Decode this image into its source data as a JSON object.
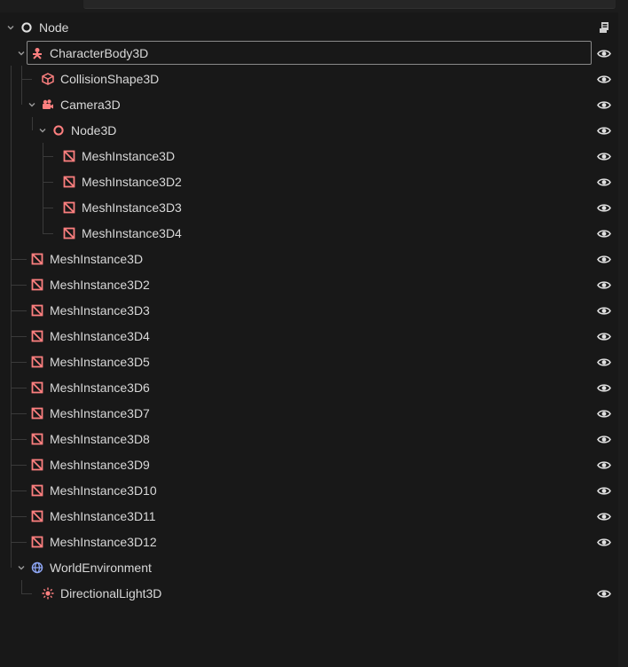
{
  "scene_tree": {
    "root": {
      "label": "Node",
      "icon": "node-icon"
    },
    "rows": [
      {
        "label": "CharacterBody3D",
        "icon": "character-body-icon",
        "selected": true
      },
      {
        "label": "CollisionShape3D",
        "icon": "collision-shape-icon"
      },
      {
        "label": "Camera3D",
        "icon": "camera-icon"
      },
      {
        "label": "Node3D",
        "icon": "node3d-icon"
      },
      {
        "label": "MeshInstance3D",
        "icon": "mesh-icon"
      },
      {
        "label": "MeshInstance3D2",
        "icon": "mesh-icon"
      },
      {
        "label": "MeshInstance3D3",
        "icon": "mesh-icon"
      },
      {
        "label": "MeshInstance3D4",
        "icon": "mesh-icon"
      },
      {
        "label": "MeshInstance3D",
        "icon": "mesh-icon"
      },
      {
        "label": "MeshInstance3D2",
        "icon": "mesh-icon"
      },
      {
        "label": "MeshInstance3D3",
        "icon": "mesh-icon"
      },
      {
        "label": "MeshInstance3D4",
        "icon": "mesh-icon"
      },
      {
        "label": "MeshInstance3D5",
        "icon": "mesh-icon"
      },
      {
        "label": "MeshInstance3D6",
        "icon": "mesh-icon"
      },
      {
        "label": "MeshInstance3D7",
        "icon": "mesh-icon"
      },
      {
        "label": "MeshInstance3D8",
        "icon": "mesh-icon"
      },
      {
        "label": "MeshInstance3D9",
        "icon": "mesh-icon"
      },
      {
        "label": "MeshInstance3D10",
        "icon": "mesh-icon"
      },
      {
        "label": "MeshInstance3D11",
        "icon": "mesh-icon"
      },
      {
        "label": "MeshInstance3D12",
        "icon": "mesh-icon"
      },
      {
        "label": "WorldEnvironment",
        "icon": "world-environment-icon"
      },
      {
        "label": "DirectionalLight3D",
        "icon": "directional-light-icon"
      }
    ]
  },
  "colors": {
    "node_3d": "#fc7f7f",
    "node_base": "#e0e0e0",
    "environment": "#8da5f3",
    "text": "#d8d8d8",
    "guide": "#3a3a3a"
  }
}
